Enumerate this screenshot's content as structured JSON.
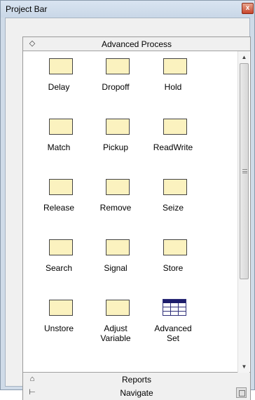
{
  "window": {
    "title": "Project Bar",
    "close_label": "x"
  },
  "sections": {
    "top": {
      "label": "Advanced Process",
      "icon": "diamond-outline-icon"
    },
    "reports": {
      "label": "Reports",
      "icon": "tag-icon"
    },
    "navigate": {
      "label": "Navigate",
      "icon": "tree-icon"
    }
  },
  "modules": [
    {
      "label": "Delay",
      "icon": "module-shape-icon"
    },
    {
      "label": "Dropoff",
      "icon": "module-shape-icon"
    },
    {
      "label": "Hold",
      "icon": "module-shape-icon"
    },
    {
      "label": "Match",
      "icon": "module-shape-icon"
    },
    {
      "label": "Pickup",
      "icon": "module-shape-icon"
    },
    {
      "label": "ReadWrite",
      "icon": "module-shape-icon"
    },
    {
      "label": "Release",
      "icon": "module-shape-icon"
    },
    {
      "label": "Remove",
      "icon": "module-shape-icon"
    },
    {
      "label": "Seize",
      "icon": "module-shape-icon"
    },
    {
      "label": "Search",
      "icon": "module-shape-icon"
    },
    {
      "label": "Signal",
      "icon": "module-shape-icon"
    },
    {
      "label": "Store",
      "icon": "module-shape-icon"
    },
    {
      "label": "Unstore",
      "icon": "module-shape-icon"
    },
    {
      "label_line1": "Adjust",
      "label_line2": "Variable",
      "icon": "module-shape-icon"
    },
    {
      "label_line1": "Advanced",
      "label_line2": "Set",
      "icon": "table-icon"
    }
  ],
  "colors": {
    "module_fill": "#fbf2bf",
    "table_header": "#1d1d6b"
  }
}
